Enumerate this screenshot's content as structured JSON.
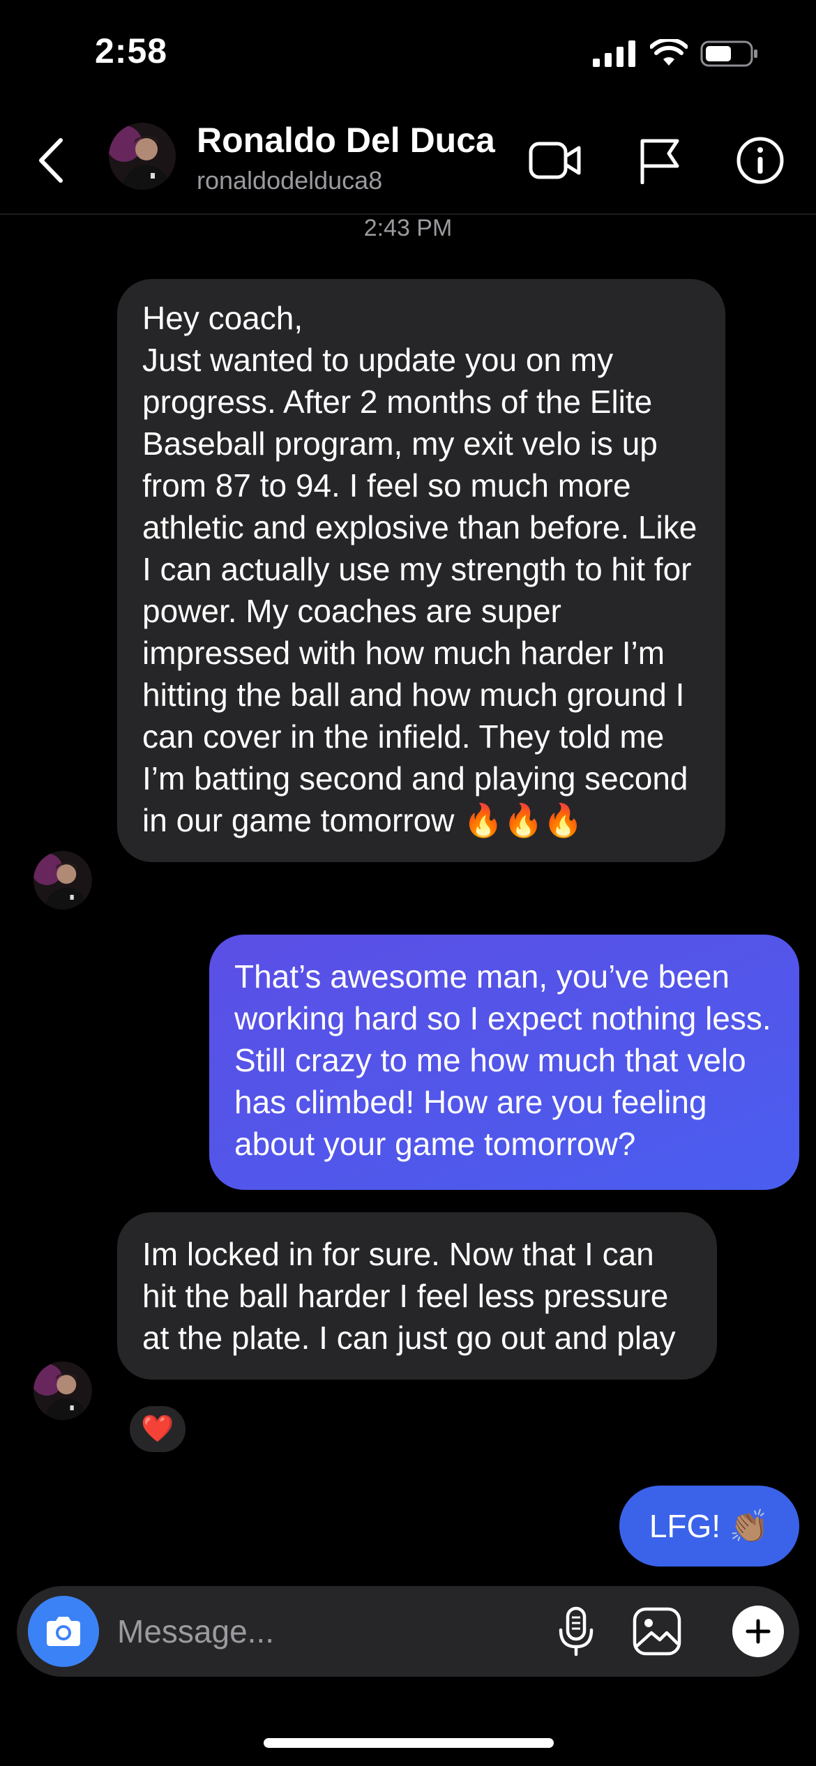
{
  "status_bar": {
    "time": "2:58"
  },
  "header": {
    "name": "Ronaldo Del Duca",
    "username": "ronaldodelduca8",
    "icons": [
      "back-chevron-icon",
      "video-call-icon",
      "flag-icon",
      "info-icon"
    ]
  },
  "thread": {
    "timestamp": "2:43 PM",
    "messages": [
      {
        "direction": "incoming",
        "lines": [
          "Hey coach,",
          "Just wanted to update you on my progress. After 2 months of the Elite Baseball program, my exit velo is up from 87 to 94. I feel so much more athletic and explosive than before. Like I can actually use my strength to hit for power. My coaches are super impressed with how much harder I’m hitting the ball and how much ground I can cover in the infield. They told me I’m batting second and playing second in our game tomorrow 🔥🔥🔥"
        ]
      },
      {
        "direction": "outgoing",
        "text": "That’s awesome man, you’ve been working hard so I expect nothing less. Still crazy to me how much that velo has climbed! How are you feeling about your game tomorrow?"
      },
      {
        "direction": "incoming",
        "text": "Im locked in for sure. Now that I can hit the ball harder I feel less pressure at the plate. I can just go out and play",
        "reaction": "❤️"
      },
      {
        "direction": "outgoing",
        "text": "LFG! 👏🏽"
      }
    ]
  },
  "composer": {
    "placeholder": "Message...",
    "icons": [
      "camera-icon",
      "microphone-icon",
      "gallery-icon",
      "plus-icon"
    ]
  },
  "colors": {
    "background": "#000000",
    "incoming_bubble": "#262628",
    "outgoing_bubble": "#5157ea",
    "outgoing_bubble_short": "#3a63ea",
    "camera_button": "#3b82f6"
  }
}
